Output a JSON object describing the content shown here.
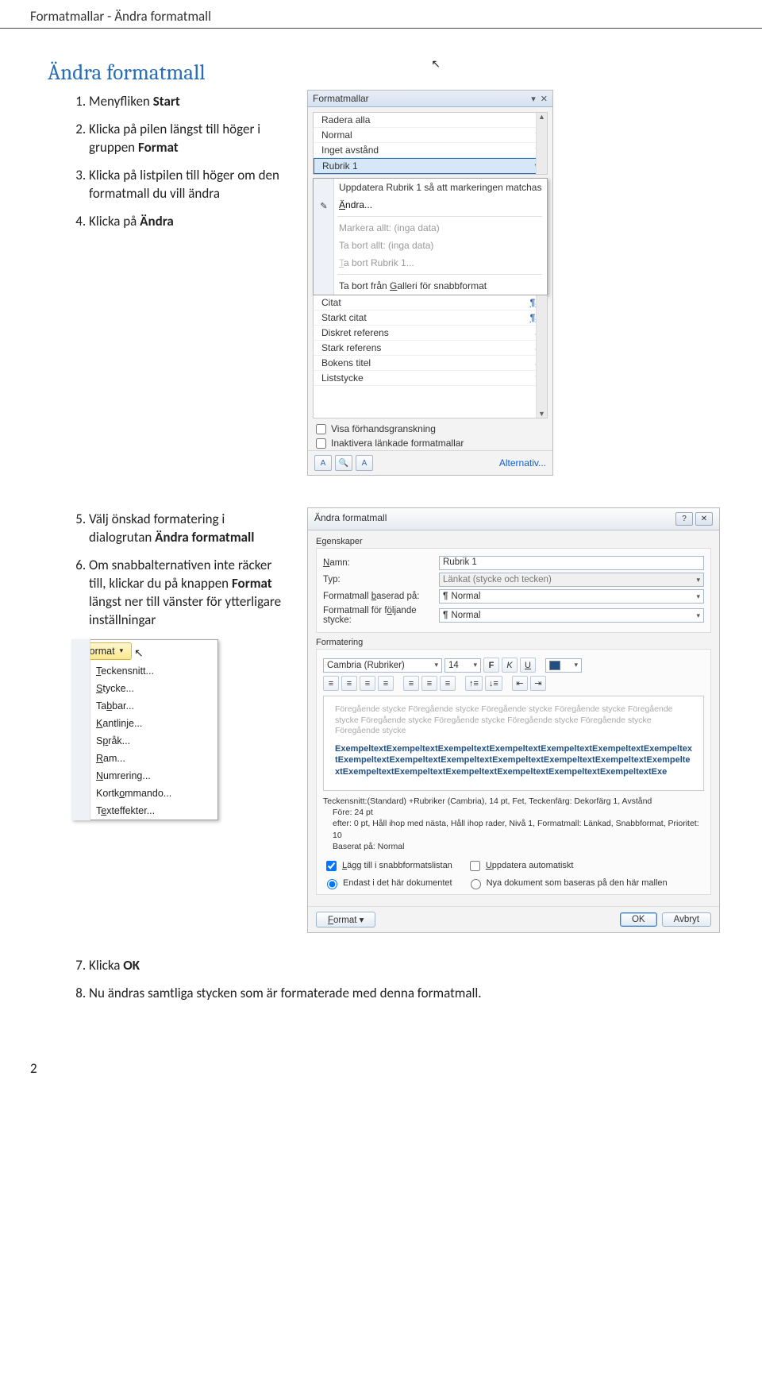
{
  "header": "Formatmallar - Ändra formatmall",
  "title": "Ändra formatmall",
  "steps": {
    "s1_pre": "Menyfliken ",
    "s1_b": "Start",
    "s2_pre": "Klicka på pilen längst till höger i gruppen ",
    "s2_b": "Format",
    "s3": "Klicka på listpilen till höger om den formatmall du vill ändra",
    "s4_pre": "Klicka på ",
    "s4_b": "Ändra",
    "s5_pre": "Välj önskad formatering i dialogrutan ",
    "s5_b": "Ändra formatmall",
    "s6_a": "Om snabbalternativen inte räcker till, klickar du på knappen ",
    "s6_b": "Format",
    "s6_c": " längst ner till vänster för ytterligare inställningar",
    "s7_pre": "Klicka ",
    "s7_b": "OK",
    "s8": "Nu ändras samtliga stycken som är formaterade med denna formatmall."
  },
  "stylesPanel": {
    "title": "Formatmallar",
    "items": [
      {
        "label": "Radera alla",
        "sym": ""
      },
      {
        "label": "Normal",
        "sym": "¶"
      },
      {
        "label": "Inget avstånd",
        "sym": "¶"
      },
      {
        "label": "Rubrik 1",
        "sym": "▾",
        "sel": true
      },
      {
        "label": "Citat",
        "sym": "¶a",
        "link": true
      },
      {
        "label": "Starkt citat",
        "sym": "¶a",
        "link": true
      },
      {
        "label": "Diskret referens",
        "sym": "a"
      },
      {
        "label": "Stark referens",
        "sym": "a"
      },
      {
        "label": "Bokens titel",
        "sym": "a"
      },
      {
        "label": "Liststycke",
        "sym": "¶"
      }
    ],
    "check1": "Visa förhandsgranskning",
    "check2": "Inaktivera länkade formatmallar",
    "alt": "Alternativ..."
  },
  "ctx": {
    "update": "Uppdatera Rubrik 1 så att markeringen matchas",
    "andra": "Ändra...",
    "markall": "Markera allt: (inga data)",
    "delall": "Ta bort allt: (inga data)",
    "delrubrik": "Ta bort Rubrik 1...",
    "delgallery": "Ta bort från Galleri för snabbformat"
  },
  "fmtMenu": {
    "btn": "Format",
    "items": [
      "Teckensnitt...",
      "Stycke...",
      "Tabbar...",
      "Kantlinje...",
      "Språk...",
      "Ram...",
      "Numrering...",
      "Kortkommando...",
      "Texteffekter..."
    ],
    "underlineIdx": [
      0,
      0,
      2,
      0,
      0,
      0,
      0,
      5,
      1
    ]
  },
  "dlg": {
    "title": "Ändra formatmall",
    "groups": {
      "props": "Egenskaper",
      "fmt": "Formatering"
    },
    "labels": {
      "name": "Namn:",
      "typ": "Typ:",
      "based": "Formatmall baserad på:",
      "next": "Formatmall för följande stycke:"
    },
    "vals": {
      "name": "Rubrik 1",
      "typ": "Länkat (stycke och tecken)",
      "based": "Normal",
      "next": "Normal",
      "font": "Cambria (Rubriker)",
      "size": "14"
    },
    "preview_grey": "Föregående stycke Föregående stycke Föregående stycke Föregående stycke Föregående stycke Föregående stycke Föregående stycke Föregående stycke Föregående stycke Föregående stycke",
    "preview_exemp": "ExempeltextExempeltextExempeltextExempeltextExempeltextExempeltextExempeltextExempeltextExempeltextExempeltextExempeltextExempeltextExempeltextExempeltextExempeltextExempeltextExempeltextExempeltextExempeltextExempeltextExe",
    "summary1": "Teckensnitt:(Standard) +Rubriker (Cambria), 14 pt, Fet, Teckenfärg: Dekorfärg 1, Avstånd",
    "summary2": "Före:  24 pt",
    "summary3": "efter:  0 pt, Håll ihop med nästa, Håll ihop rader, Nivå 1, Formatmall: Länkad, Snabbformat, Prioritet: 10",
    "summary4": "Baserat på: Normal",
    "opt_add": "Lägg till i snabbformatslistan",
    "opt_auto": "Uppdatera automatiskt",
    "opt_this": "Endast i det här dokumentet",
    "opt_new": "Nya dokument som baseras på den här mallen",
    "btn_fmt": "Format ▾",
    "btn_ok": "OK",
    "btn_cancel": "Avbryt"
  },
  "pageNum": "2"
}
